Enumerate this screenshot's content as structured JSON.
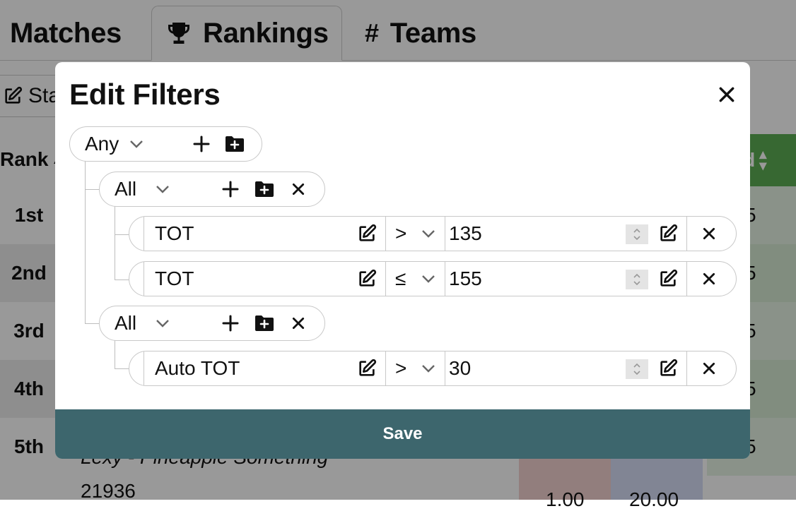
{
  "tabs": [
    {
      "label": "Matches"
    },
    {
      "label": "Rankings",
      "icon": "trophy-icon"
    },
    {
      "label": "Teams",
      "icon": "hash-icon"
    }
  ],
  "toolbar": {
    "button_label": "Sta",
    "icon": "edit-icon"
  },
  "table": {
    "rank_header": "Rank",
    "played_header": "yed",
    "rows": [
      {
        "rank": "1st",
        "played": "5"
      },
      {
        "rank": "2nd",
        "played": "5"
      },
      {
        "rank": "3rd",
        "played": "5"
      },
      {
        "rank": "4th",
        "played": "5"
      },
      {
        "rank": "5th",
        "played": "5",
        "team_name": "Lexy - Pineapple Something",
        "team_number": "21936"
      }
    ],
    "partial_values": [
      "1.00",
      "20.00",
      "5"
    ]
  },
  "modal": {
    "title": "Edit Filters",
    "root_group": {
      "mode": "Any"
    },
    "groups": [
      {
        "mode": "All",
        "rules": [
          {
            "field": "TOT",
            "operator": ">",
            "value": "135"
          },
          {
            "field": "TOT",
            "operator": "≤",
            "value": "155"
          }
        ]
      },
      {
        "mode": "All",
        "rules": [
          {
            "field": "Auto TOT",
            "operator": ">",
            "value": "30"
          }
        ]
      }
    ],
    "save_label": "Save"
  },
  "colors": {
    "save_bar": "#3d666d",
    "played_header": "#5cae54"
  }
}
